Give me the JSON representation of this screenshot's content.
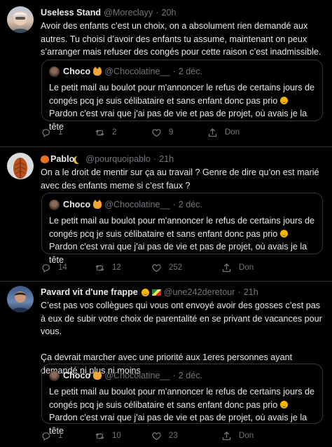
{
  "tweets": [
    {
      "name": "Useless Stand",
      "handle": "@Moreclayy",
      "sep": "·",
      "time": "20h",
      "text": "Avoir des enfants c’est un choix, on a absolument rien demandé aux autres. Tu choisi d’avoir des enfants tu assume, maintenant on peux s’arranger mais refuser des congés pour cette raison c’est inadmissible.",
      "quote": {
        "name": "Choco",
        "handle": "@Chocolatine__",
        "sep": "·",
        "date": "2 déc.",
        "line1": "Le petit mail au boulot pour m'annoncer le refus de certains jours de congés pcq je suis célibataire et sans enfant donc pas prio",
        "line2": "Pardon c'est vrai que j'ai pas de vie et pas de projet, où avais je la tête"
      },
      "replies": "1",
      "retweets": "2",
      "likes": "9",
      "share": "Don"
    },
    {
      "name": "Pablo",
      "handle": "@pourquoipablo",
      "sep": "·",
      "time": "21h",
      "text": "On a le droit de mentir sur ça au travail ? Genre de dire qu’on est marié avec des enfants meme si c’est faux ?",
      "quote": {
        "name": "Choco",
        "handle": "@Chocolatine__",
        "sep": "·",
        "date": "2 déc.",
        "line1": "Le petit mail au boulot pour m'annoncer le refus de certains jours de congés pcq je suis célibataire et sans enfant donc pas prio",
        "line2": "Pardon c'est vrai que j'ai pas de vie et pas de projet, où avais je la tête"
      },
      "replies": "14",
      "retweets": "12",
      "likes": "252",
      "share": "Don"
    },
    {
      "name": "Pavard vit d'une frappe",
      "handle": "@une242deretour",
      "sep": "·",
      "time": "21h",
      "text": "C’est pas vos collègues qui vous ont envoyé avoir des gosses c’est pas à eux de subir votre choix de parentalité en se privant de vacances pour vous.\n\nÇa devrait marcher avec une priorité aux 1eres personnes ayant demandé ni plus ni moins",
      "quote": {
        "name": "Choco",
        "handle": "@Chocolatine__",
        "sep": "·",
        "date": "2 déc.",
        "line1": "Le petit mail au boulot pour m'annoncer le refus de certains jours de congés pcq je suis célibataire et sans enfant donc pas prio",
        "line2": "Pardon c'est vrai que j'ai pas de vie et pas de projet, où avais je la tête"
      },
      "replies": "1",
      "retweets": "10",
      "likes": "23",
      "share": "Don"
    }
  ],
  "colors": {
    "background": "#000000",
    "text": "#e7e9ea",
    "muted": "#71767b",
    "border": "#2f3336"
  },
  "icons": [
    "reply-icon",
    "retweet-icon",
    "like-icon",
    "share-icon",
    "cat-emoji-icon",
    "upside-down-face-emoji-icon"
  ]
}
